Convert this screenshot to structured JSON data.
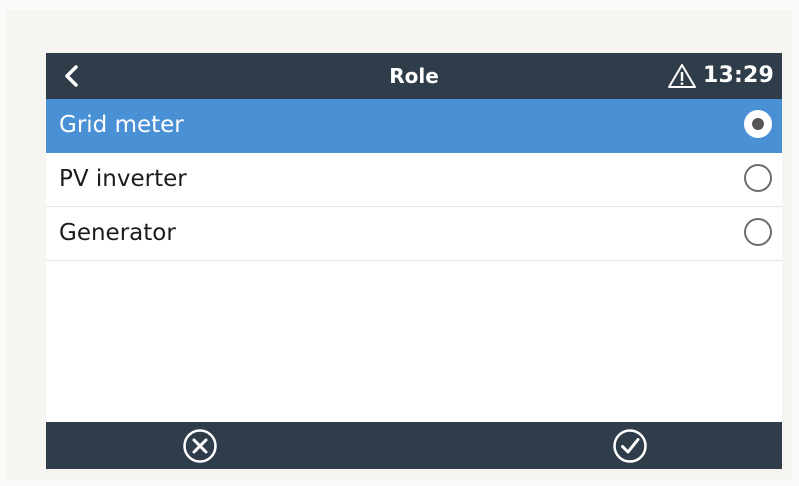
{
  "header": {
    "title": "Role",
    "back_icon": "chevron-left-icon",
    "alert_icon": "warning-triangle-icon",
    "time": "13:29"
  },
  "options": [
    {
      "label": "Grid meter",
      "selected": true
    },
    {
      "label": "PV inverter",
      "selected": false
    },
    {
      "label": "Generator",
      "selected": false
    }
  ],
  "footer": {
    "cancel_icon": "cancel-circle-icon",
    "confirm_icon": "check-circle-icon"
  },
  "colors": {
    "bar": "#2f3d4a",
    "selected_row": "#4a90d4",
    "text": "#1c1c1c"
  }
}
